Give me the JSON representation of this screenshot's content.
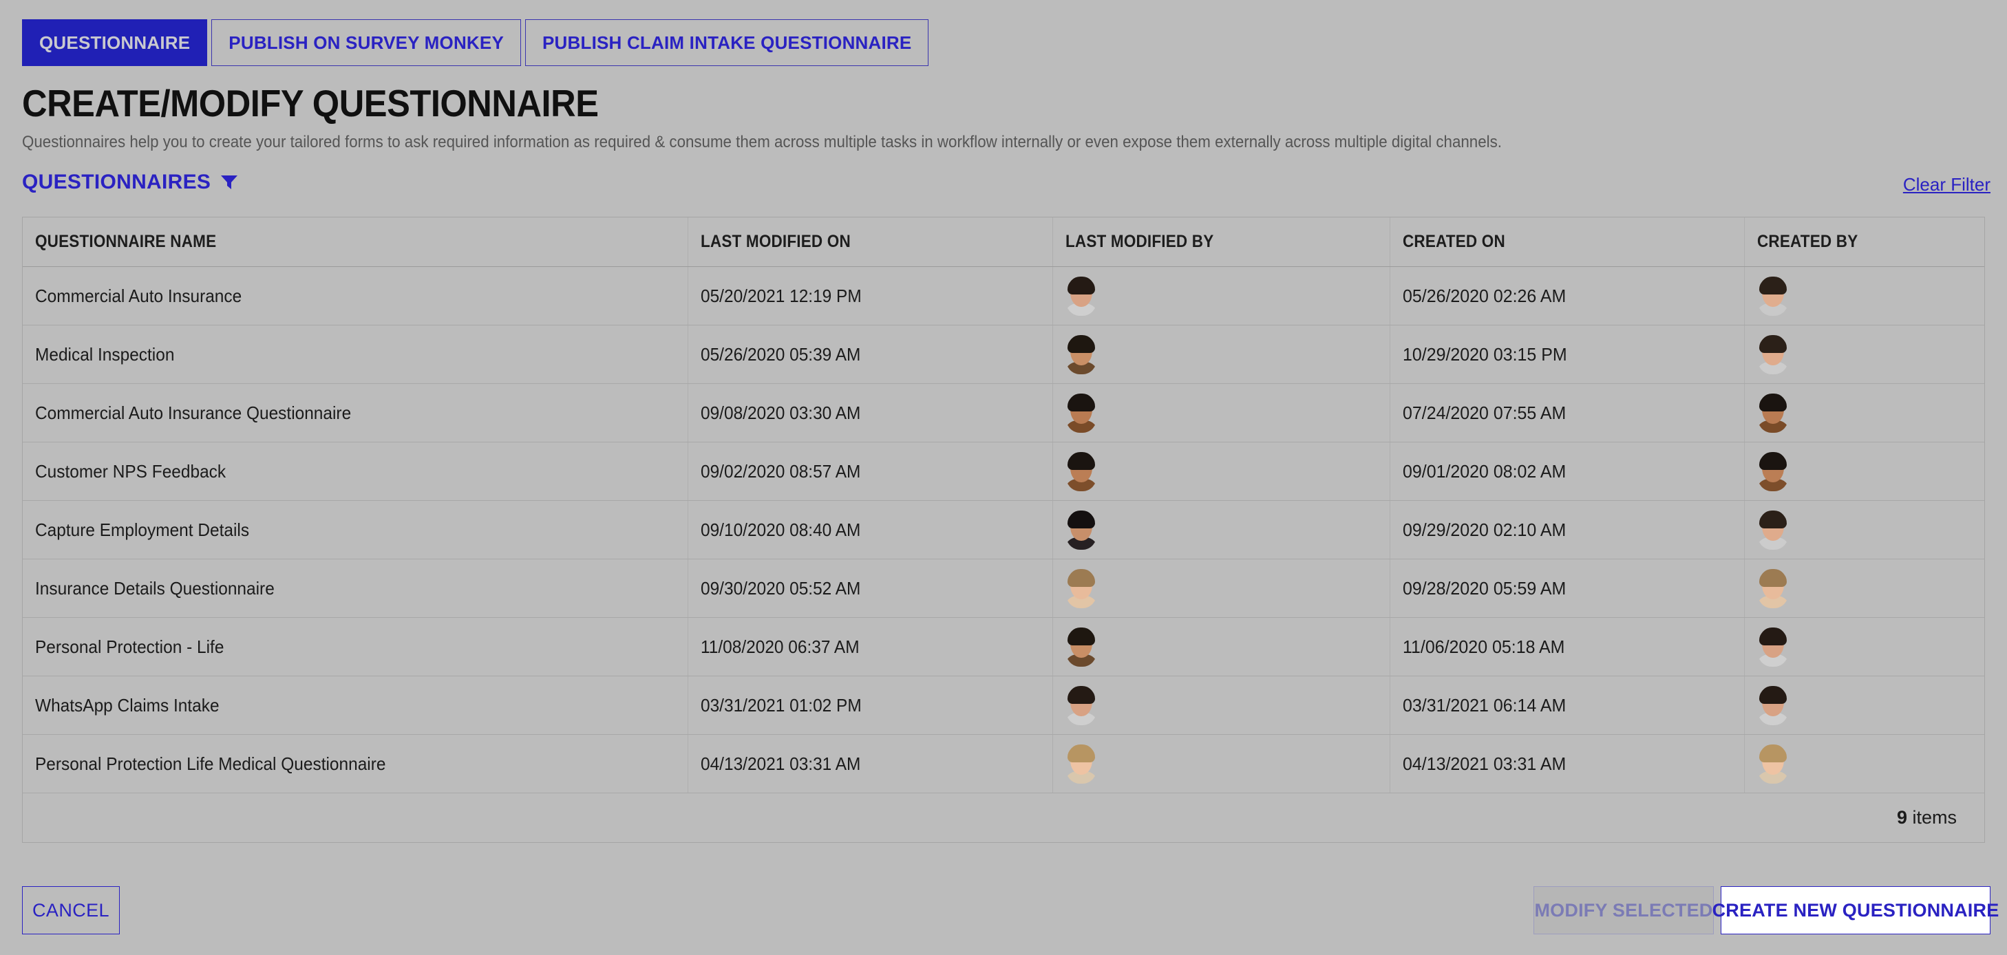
{
  "tabs": [
    {
      "label": "QUESTIONNAIRE",
      "active": true
    },
    {
      "label": "PUBLISH ON SURVEY MONKEY",
      "active": false
    },
    {
      "label": "PUBLISH CLAIM INTAKE QUESTIONNAIRE",
      "active": false
    }
  ],
  "header": {
    "title": "CREATE/MODIFY QUESTIONNAIRE",
    "subtitle": "Questionnaires help you to create your tailored forms to ask required information as required & consume them across multiple tasks in workflow internally or even expose them externally across multiple digital channels."
  },
  "section": {
    "title": "QUESTIONNAIRES",
    "filter_icon": "filter-funnel-icon",
    "clear_filter_label": "Clear Filter"
  },
  "table": {
    "columns": [
      "QUESTIONNAIRE NAME",
      "LAST MODIFIED ON",
      "LAST MODIFIED BY",
      "CREATED ON",
      "CREATED BY"
    ],
    "rows": [
      {
        "name": "Commercial Auto Insurance",
        "last_modified_on": "05/20/2021 12:19 PM",
        "last_modified_by": {
          "icon": "user-avatar",
          "hair": "#241a14",
          "skin": "#d8a284",
          "body": "#cfcfcf"
        },
        "created_on": "05/26/2020 02:26 AM",
        "created_by": {
          "icon": "user-avatar",
          "hair": "#2b2018",
          "skin": "#e0ad8e",
          "body": "#c9c9c9"
        }
      },
      {
        "name": "Medical Inspection",
        "last_modified_on": "05/26/2020 05:39 AM",
        "last_modified_by": {
          "icon": "user-avatar",
          "hair": "#1e1710",
          "skin": "#c98f66",
          "body": "#6b4a2d"
        },
        "created_on": "10/29/2020 03:15 PM",
        "created_by": {
          "icon": "user-avatar",
          "hair": "#2b2018",
          "skin": "#dfab8c",
          "body": "#cccccc"
        }
      },
      {
        "name": "Commercial Auto Insurance Questionnaire",
        "last_modified_on": "09/08/2020 03:30 AM",
        "last_modified_by": {
          "icon": "user-avatar",
          "hair": "#1a1410",
          "skin": "#b97b52",
          "body": "#7a4b28"
        },
        "created_on": "07/24/2020 07:55 AM",
        "created_by": {
          "icon": "user-avatar",
          "hair": "#1a1410",
          "skin": "#b97b52",
          "body": "#7a4b28"
        }
      },
      {
        "name": "Customer NPS Feedback",
        "last_modified_on": "09/02/2020 08:57 AM",
        "last_modified_by": {
          "icon": "user-avatar",
          "hair": "#1a1410",
          "skin": "#bb7e55",
          "body": "#7d4e2b"
        },
        "created_on": "09/01/2020 08:02 AM",
        "created_by": {
          "icon": "user-avatar",
          "hair": "#1a1410",
          "skin": "#bb7e55",
          "body": "#7d4e2b"
        }
      },
      {
        "name": "Capture Employment Details",
        "last_modified_on": "09/10/2020 08:40 AM",
        "last_modified_by": {
          "icon": "user-avatar",
          "hair": "#141010",
          "skin": "#c78f6a",
          "body": "#262022"
        },
        "created_on": "09/29/2020 02:10 AM",
        "created_by": {
          "icon": "user-avatar",
          "hair": "#2b2018",
          "skin": "#dfab8c",
          "body": "#cccccc"
        }
      },
      {
        "name": "Insurance Details Questionnaire",
        "last_modified_on": "09/30/2020 05:52 AM",
        "last_modified_by": {
          "icon": "user-avatar",
          "hair": "#9c7b52",
          "skin": "#e8bb9b",
          "body": "#e2c5a6"
        },
        "created_on": "09/28/2020 05:59 AM",
        "created_by": {
          "icon": "user-avatar",
          "hair": "#9c7b52",
          "skin": "#e8bb9b",
          "body": "#e2c5a6"
        }
      },
      {
        "name": "Personal Protection - Life",
        "last_modified_on": "11/08/2020 06:37 AM",
        "last_modified_by": {
          "icon": "user-avatar",
          "hair": "#1e1710",
          "skin": "#c98f66",
          "body": "#6b4a2d"
        },
        "created_on": "11/06/2020 05:18 AM",
        "created_by": {
          "icon": "user-avatar",
          "hair": "#241a14",
          "skin": "#d8a284",
          "body": "#cfcfcf"
        }
      },
      {
        "name": "WhatsApp Claims Intake",
        "last_modified_on": "03/31/2021 01:02 PM",
        "last_modified_by": {
          "icon": "user-avatar",
          "hair": "#241a14",
          "skin": "#d8a284",
          "body": "#cfcfcf"
        },
        "created_on": "03/31/2021 06:14 AM",
        "created_by": {
          "icon": "user-avatar",
          "hair": "#241a14",
          "skin": "#d8a284",
          "body": "#cfcfcf"
        }
      },
      {
        "name": "Personal Protection Life Medical Questionnaire",
        "last_modified_on": "04/13/2021 03:31 AM",
        "last_modified_by": {
          "icon": "user-avatar",
          "hair": "#b79562",
          "skin": "#eec3a3",
          "body": "#d9c7ad"
        },
        "created_on": "04/13/2021 03:31 AM",
        "created_by": {
          "icon": "user-avatar",
          "hair": "#b79562",
          "skin": "#eec3a3",
          "body": "#d9c7ad"
        }
      }
    ],
    "footer": {
      "count": "9",
      "count_label": "items"
    }
  },
  "actions": {
    "cancel_label": "CANCEL",
    "modify_selected_label": "MODIFY SELECTED",
    "create_new_label": "CREATE NEW QUESTIONNAIRE"
  },
  "colors": {
    "accent": "#2a22c2",
    "tab_active_bg": "#2020b5",
    "page_bg": "#bcbcbc",
    "border": "#a8a8a8",
    "disabled_text": "#7b7bb5"
  }
}
